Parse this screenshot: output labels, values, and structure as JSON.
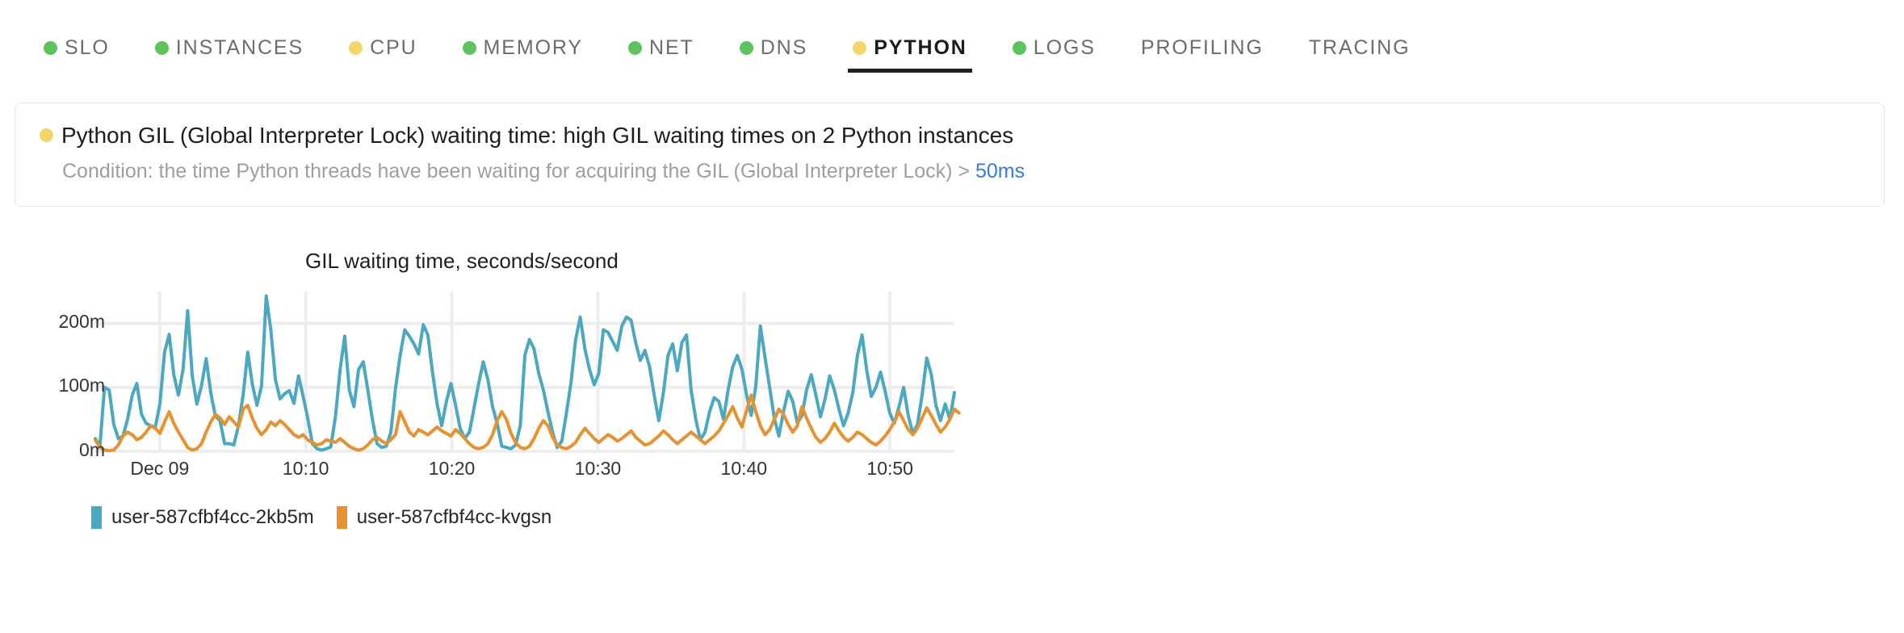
{
  "tabs": [
    {
      "label": "SLO",
      "status": "green",
      "active": false
    },
    {
      "label": "INSTANCES",
      "status": "green",
      "active": false
    },
    {
      "label": "CPU",
      "status": "yellow",
      "active": false
    },
    {
      "label": "MEMORY",
      "status": "green",
      "active": false
    },
    {
      "label": "NET",
      "status": "green",
      "active": false
    },
    {
      "label": "DNS",
      "status": "green",
      "active": false
    },
    {
      "label": "PYTHON",
      "status": "yellow",
      "active": true
    },
    {
      "label": "LOGS",
      "status": "green",
      "active": false
    },
    {
      "label": "PROFILING",
      "status": "none",
      "active": false
    },
    {
      "label": "TRACING",
      "status": "none",
      "active": false
    }
  ],
  "alert": {
    "status": "yellow",
    "title": "Python GIL (Global Interpreter Lock) waiting time: high GIL waiting times on 2 Python instances",
    "condition_prefix": "Condition: the time Python threads have been waiting for acquiring the GIL (Global Interpreter Lock) > ",
    "threshold": "50ms"
  },
  "colors": {
    "green": "#5cc45c",
    "yellow": "#f5d565",
    "link": "#2f7de1",
    "series_a": "#4aa8c0",
    "series_b": "#e8922f",
    "grid": "#ededed"
  },
  "chart_data": {
    "type": "line",
    "title": "GIL waiting time, seconds/second",
    "xlabel": "",
    "ylabel": "",
    "ylim": [
      0,
      250
    ],
    "yticks": [
      0,
      100,
      200
    ],
    "ytick_labels": [
      "0m",
      "100m",
      "200m"
    ],
    "grid": true,
    "legend_position": "bottom-left",
    "xtick_labels": [
      "Dec 09",
      "10:10",
      "10:20",
      "10:30",
      "10:40",
      "10:50"
    ],
    "xtick_positions": [
      0.075,
      0.245,
      0.415,
      0.585,
      0.755,
      0.925
    ],
    "series": [
      {
        "name": "user-587cfbf4cc-2kb5m",
        "color": "#4aa8c0",
        "values": [
          20,
          8,
          100,
          96,
          42,
          20,
          24,
          50,
          88,
          106,
          58,
          44,
          40,
          38,
          75,
          155,
          183,
          120,
          88,
          128,
          220,
          118,
          74,
          103,
          145,
          92,
          55,
          48,
          12,
          12,
          10,
          40,
          88,
          155,
          105,
          72,
          102,
          243,
          190,
          112,
          82,
          90,
          95,
          75,
          118,
          86,
          52,
          12,
          4,
          2,
          4,
          7,
          55,
          128,
          180,
          96,
          70,
          128,
          140,
          96,
          50,
          12,
          6,
          8,
          30,
          98,
          150,
          190,
          180,
          168,
          152,
          198,
          182,
          124,
          74,
          40,
          78,
          106,
          72,
          36,
          20,
          30,
          68,
          106,
          140,
          112,
          70,
          44,
          8,
          6,
          4,
          10,
          40,
          150,
          175,
          160,
          122,
          96,
          62,
          30,
          6,
          16,
          60,
          108,
          175,
          210,
          160,
          128,
          104,
          122,
          190,
          186,
          172,
          158,
          196,
          210,
          205,
          170,
          142,
          158,
          132,
          88,
          48,
          92,
          150,
          168,
          126,
          170,
          182,
          96,
          50,
          18,
          30,
          62,
          84,
          78,
          50,
          96,
          132,
          150,
          128,
          88,
          56,
          102,
          196,
          146,
          100,
          52,
          24,
          62,
          94,
          78,
          44,
          56,
          96,
          120,
          88,
          54,
          82,
          118,
          96,
          66,
          40,
          60,
          92,
          150,
          182,
          128,
          86,
          100,
          124,
          94,
          60,
          44,
          70,
          100,
          56,
          28,
          42,
          88,
          146,
          120,
          72,
          48,
          74,
          50,
          92
        ]
      },
      {
        "name": "user-587cfbf4cc-kvgsn",
        "color": "#e8922f",
        "values": [
          18,
          6,
          2,
          1,
          2,
          10,
          24,
          30,
          26,
          18,
          22,
          30,
          40,
          36,
          28,
          46,
          62,
          44,
          30,
          18,
          6,
          2,
          4,
          12,
          30,
          46,
          58,
          52,
          42,
          54,
          46,
          38,
          66,
          72,
          52,
          36,
          26,
          34,
          46,
          40,
          48,
          42,
          34,
          26,
          22,
          26,
          18,
          14,
          10,
          12,
          18,
          16,
          14,
          20,
          14,
          8,
          4,
          2,
          4,
          10,
          18,
          22,
          16,
          12,
          18,
          26,
          62,
          46,
          30,
          24,
          34,
          30,
          26,
          32,
          38,
          32,
          28,
          24,
          34,
          28,
          20,
          12,
          6,
          4,
          6,
          12,
          26,
          48,
          62,
          50,
          28,
          14,
          6,
          4,
          8,
          20,
          36,
          48,
          40,
          22,
          10,
          6,
          4,
          8,
          14,
          26,
          36,
          28,
          20,
          14,
          20,
          26,
          22,
          16,
          20,
          26,
          32,
          22,
          16,
          10,
          12,
          18,
          24,
          32,
          26,
          18,
          12,
          18,
          24,
          30,
          24,
          18,
          12,
          18,
          24,
          32,
          44,
          56,
          70,
          52,
          38,
          64,
          88,
          62,
          40,
          26,
          34,
          50,
          66,
          58,
          42,
          30,
          40,
          70,
          52,
          36,
          22,
          14,
          20,
          30,
          44,
          32,
          22,
          16,
          22,
          30,
          26,
          20,
          14,
          10,
          16,
          24,
          34,
          46,
          62,
          48,
          34,
          26,
          36,
          52,
          68,
          56,
          42,
          30,
          38,
          50,
          66,
          60
        ]
      }
    ]
  }
}
